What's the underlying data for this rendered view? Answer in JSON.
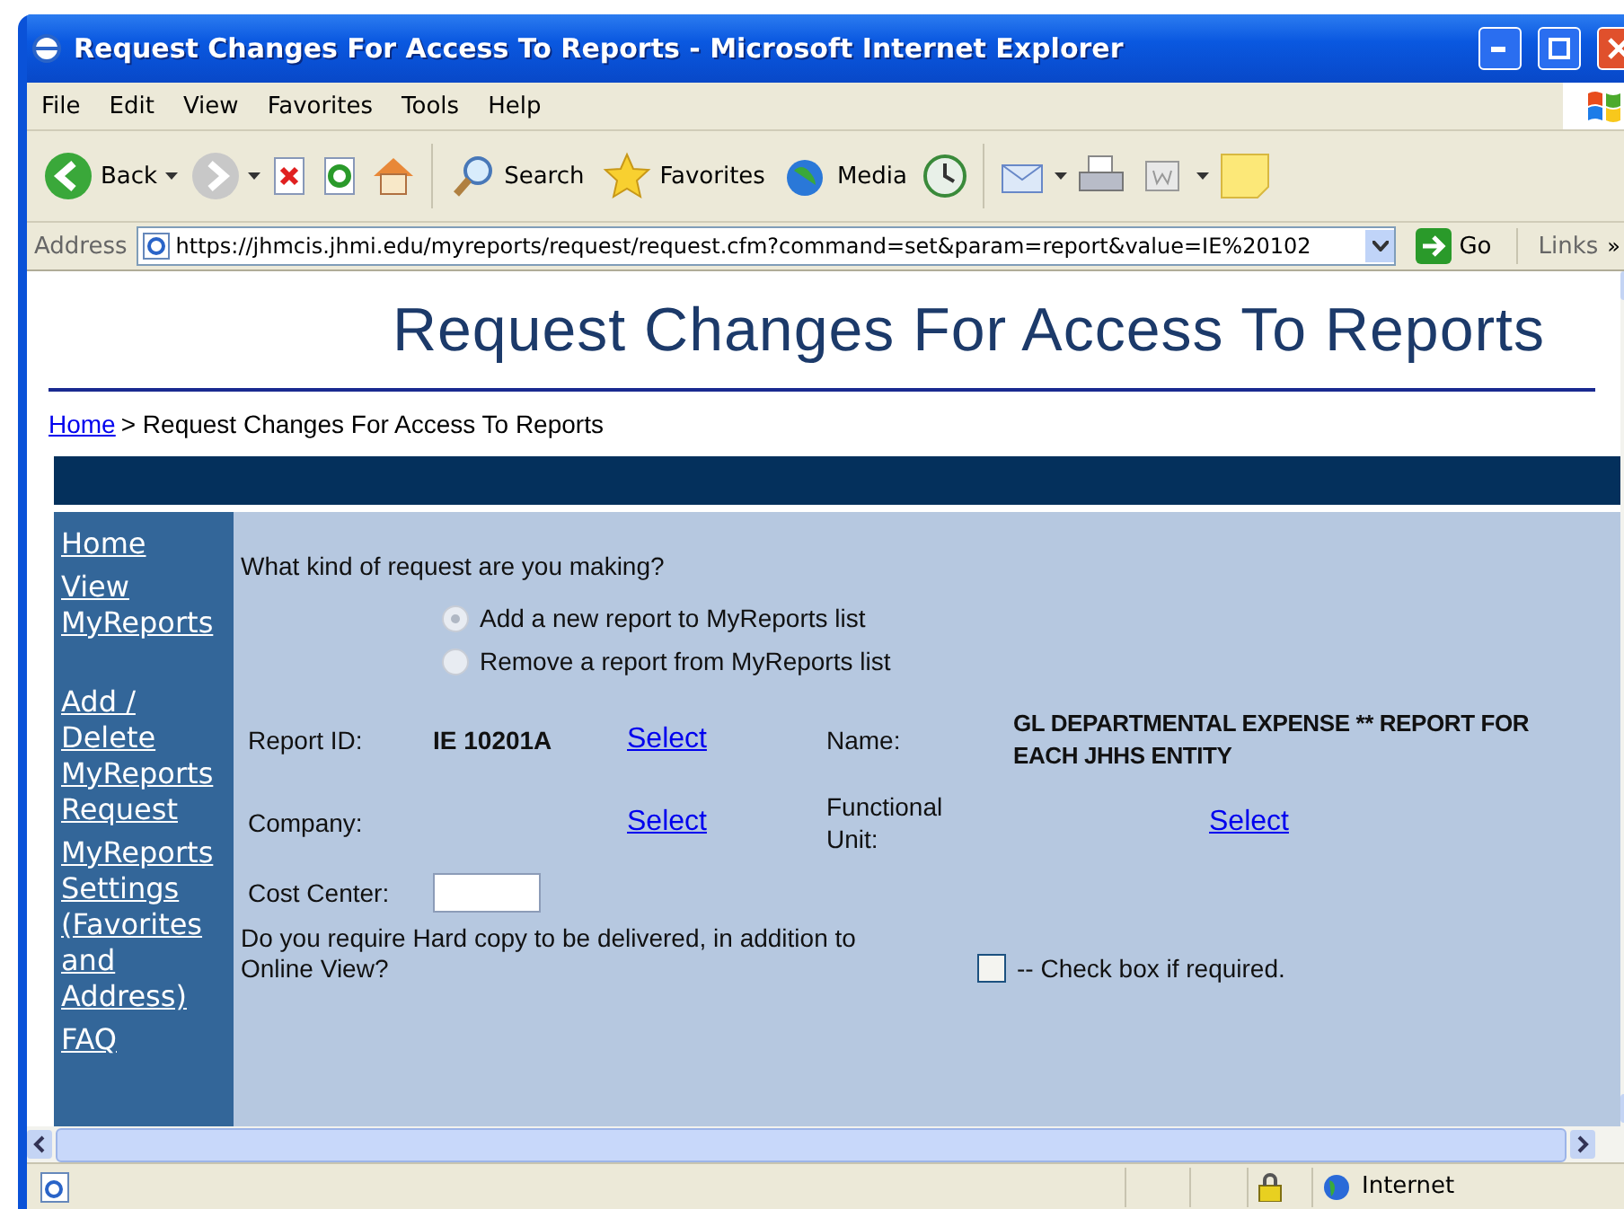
{
  "window": {
    "title": "Request Changes For Access To Reports - Microsoft Internet Explorer"
  },
  "menu": [
    "File",
    "Edit",
    "View",
    "Favorites",
    "Tools",
    "Help"
  ],
  "toolbar": {
    "back_label": "Back",
    "search_label": "Search",
    "favorites_label": "Favorites",
    "media_label": "Media"
  },
  "address_bar": {
    "label": "Address",
    "url": "https://jhmcis.jhmi.edu/myreports/request/request.cfm?command=set&param=report&value=IE%20102",
    "go_label": "Go",
    "links_label": "Links",
    "more": "»"
  },
  "page": {
    "title": "Request Changes For Access To Reports",
    "breadcrumb": {
      "link": "Home ",
      "rest": "> Request Changes For Access To Reports"
    },
    "sidebar_groups": [
      [
        "Home",
        "View MyReports"
      ],
      [
        "Add / Delete MyReports Request",
        "MyReports Settings (Favorites and Address)",
        "FAQ"
      ]
    ],
    "form": {
      "question": "What kind of request are you making?",
      "options": [
        {
          "label": "Add a new report to MyReports list",
          "selected": true
        },
        {
          "label": "Remove a report from MyReports list",
          "selected": false
        }
      ],
      "report_id": {
        "label": "Report ID:",
        "value": "IE 10201A",
        "link": "Select"
      },
      "name": {
        "label": "Name:",
        "value": "GL DEPARTMENTAL EXPENSE ** REPORT FOR EACH JHHS ENTITY"
      },
      "company": {
        "label": "Company:",
        "link": "Select"
      },
      "functional_unit": {
        "label": "Functional Unit:",
        "link": "Select"
      },
      "cost_center": {
        "label": "Cost Center:"
      },
      "hard_copy": {
        "question": "Do you require Hard copy to be delivered, in addition to Online View?",
        "checkbox_label": "-- Check box if required.",
        "checked": false
      }
    }
  },
  "status_bar": {
    "zone": "Internet"
  }
}
